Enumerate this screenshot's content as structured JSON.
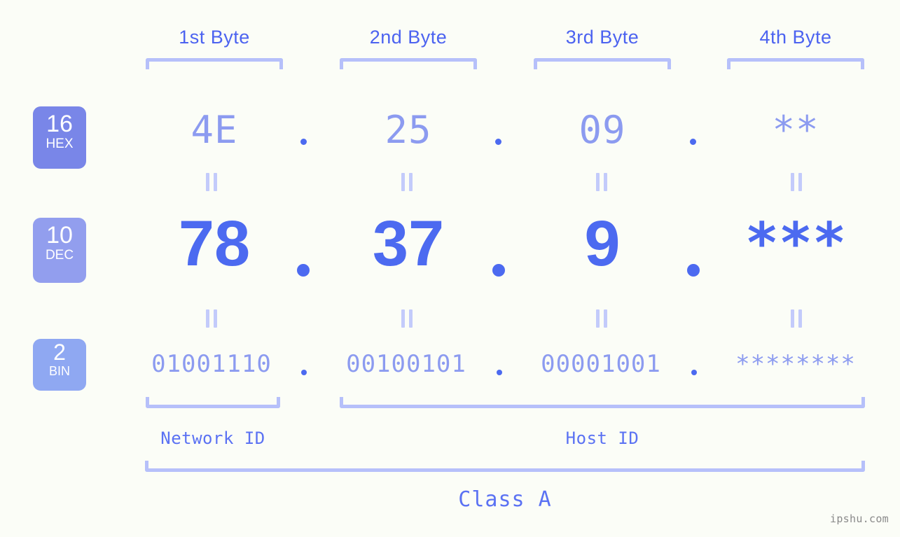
{
  "meta": {
    "background_color": "#fbfdf7",
    "watermark": "ipshu.com"
  },
  "byte_headers": [
    {
      "label": "1st Byte"
    },
    {
      "label": "2nd Byte"
    },
    {
      "label": "3rd Byte"
    },
    {
      "label": "4th Byte"
    }
  ],
  "rows": {
    "hex": {
      "badge_number": "16",
      "badge_label": "HEX",
      "badge_color": "#7986e8",
      "value_color": "#8c9bf0",
      "values": [
        "4E",
        "25",
        "09",
        "**"
      ]
    },
    "dec": {
      "badge_number": "10",
      "badge_label": "DEC",
      "badge_color": "#929eee",
      "value_color": "#4c6af0",
      "values": [
        "78",
        "37",
        "9",
        "***"
      ]
    },
    "bin": {
      "badge_number": "2",
      "badge_label": "BIN",
      "badge_color": "#8fa8f2",
      "value_color": "#8c9bf0",
      "values": [
        "01001110",
        "00100101",
        "00001001",
        "********"
      ]
    }
  },
  "separator": ".",
  "equality_sign": "=",
  "footer": {
    "network_id_label": "Network ID",
    "host_id_label": "Host ID",
    "class_label": "Class A"
  },
  "colors": {
    "bracket": "#b6c0fa",
    "header_text": "#4c63f0",
    "equality": "#c3cbfb",
    "dot": "#4c6af0",
    "footer_text": "#5b72f3",
    "watermark_text": "#8a8a8a"
  }
}
